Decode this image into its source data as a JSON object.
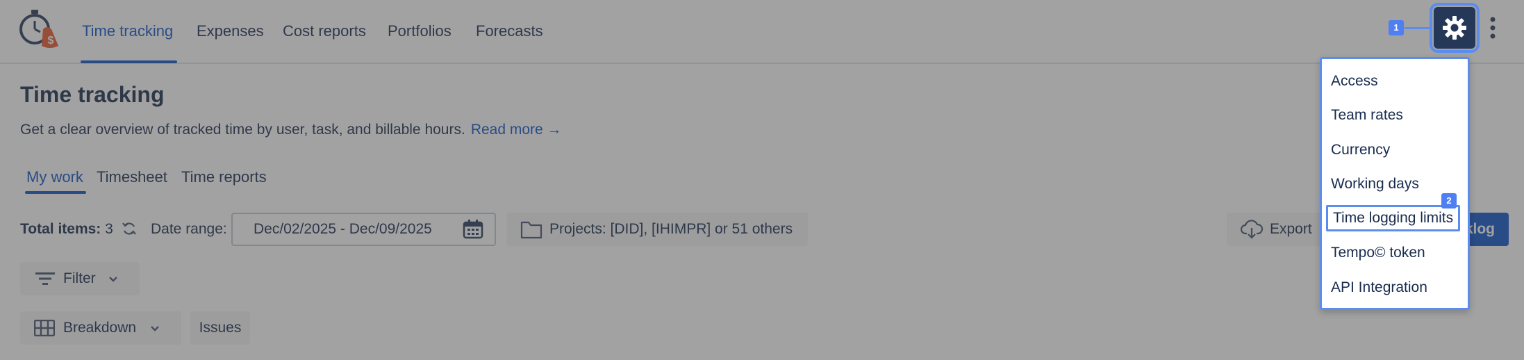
{
  "nav": {
    "tabs": [
      {
        "label": "Time tracking",
        "active": true
      },
      {
        "label": "Expenses"
      },
      {
        "label": "Cost reports"
      },
      {
        "label": "Portfolios"
      },
      {
        "label": "Forecasts"
      }
    ]
  },
  "header": {
    "title": "Time tracking",
    "description": "Get a clear overview of tracked time by user, task, and billable hours.",
    "read_more": "Read more →"
  },
  "subtabs": [
    "My work",
    "Timesheet",
    "Time reports"
  ],
  "toolbar": {
    "total_label": "Total items:",
    "total_value": "3",
    "date_range_label": "Date range:",
    "date_range_value": "Dec/02/2025 - Dec/09/2025",
    "projects_label": "Projects: [DID], [IHIMPR] or 51 others",
    "export_label": "Export",
    "worklog_label": "klog",
    "filter_label": "Filter",
    "breakdown_label": "Breakdown",
    "issues_label": "Issues"
  },
  "settings_menu": {
    "items": [
      "Access",
      "Team rates",
      "Currency",
      "Working days",
      "Time logging limits",
      "Tempo© token",
      "API Integration"
    ]
  },
  "annotations": {
    "badge_1": "1",
    "badge_2": "2"
  },
  "colors": {
    "accent": "#0c53c9",
    "highlight": "#5b8def",
    "gear_bg": "#253858",
    "logo_orange": "#e8562a"
  }
}
